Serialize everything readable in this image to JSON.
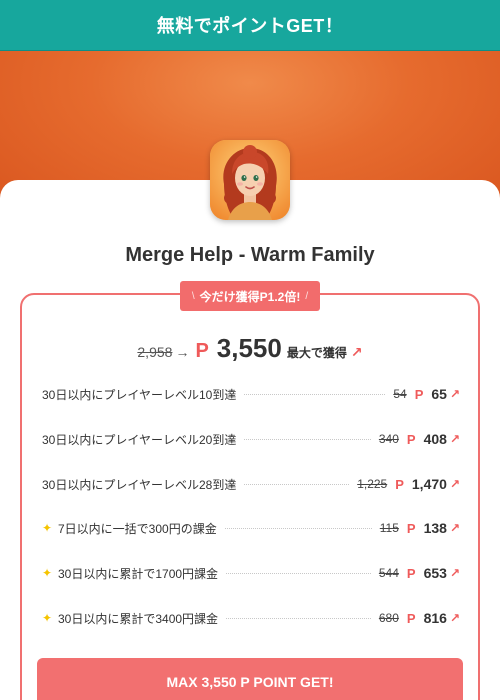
{
  "header": {
    "title": "無料でポイントGET！"
  },
  "app": {
    "title": "Merge Help - Warm Family"
  },
  "promo": {
    "slash_left": "\\",
    "label": "今だけ獲得P1.2倍!",
    "slash_right": "/"
  },
  "total": {
    "old": "2,958",
    "arrow": "→",
    "currency": "P",
    "value": "3,550",
    "suffix": "最大で獲得",
    "up": "↗"
  },
  "tasks": [
    {
      "star": false,
      "label": "30日以内にプレイヤーレベル10到達",
      "old": "54",
      "currency": "P",
      "new": "65",
      "up": "↗"
    },
    {
      "star": false,
      "label": "30日以内にプレイヤーレベル20到達",
      "old": "340",
      "currency": "P",
      "new": "408",
      "up": "↗"
    },
    {
      "star": false,
      "label": "30日以内にプレイヤーレベル28到達",
      "old": "1,225",
      "currency": "P",
      "new": "1,470",
      "up": "↗"
    },
    {
      "star": true,
      "star_glyph": "✦",
      "label": "7日以内に一括で300円の課金",
      "old": "115",
      "currency": "P",
      "new": "138",
      "up": "↗"
    },
    {
      "star": true,
      "star_glyph": "✦",
      "label": "30日以内に累計で1700円課金",
      "old": "544",
      "currency": "P",
      "new": "653",
      "up": "↗"
    },
    {
      "star": true,
      "star_glyph": "✦",
      "label": "30日以内に累計で3400円課金",
      "old": "680",
      "currency": "P",
      "new": "816",
      "up": "↗"
    }
  ],
  "cta": {
    "label": "MAX 3,550 P POINT GET!"
  },
  "colors": {
    "header": "#17a79d",
    "accent": "#ef5a5a",
    "hero": "#e66b2e"
  },
  "icons": {
    "app": "app-character-icon",
    "star": "sparkle-icon",
    "up": "arrow-up-right-icon"
  }
}
